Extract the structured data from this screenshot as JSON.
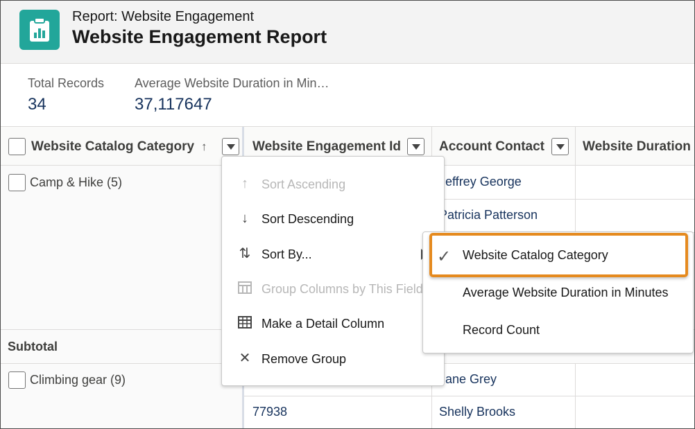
{
  "header": {
    "object_label": "Report: Website Engagement",
    "title": "Website Engagement Report",
    "icon": "report-icon",
    "icon_color": "#22a69a"
  },
  "summary": {
    "metrics": [
      {
        "label": "Total Records",
        "value": "34"
      },
      {
        "label": "Average Website Duration in Min…",
        "value": "37,117647"
      }
    ]
  },
  "table": {
    "columns": [
      {
        "label": "Website Catalog Category",
        "sort_icon": "arrow-up-icon"
      },
      {
        "label": "Website Engagement Id"
      },
      {
        "label": "Account Contact"
      },
      {
        "label": "Website Duration i"
      }
    ],
    "groups": [
      {
        "label": "Camp & Hike (5)"
      },
      {
        "label": "Climbing gear (9)"
      }
    ],
    "subtotal_label": "Subtotal",
    "rows": [
      {
        "id": "",
        "contact": "Jeffrey George"
      },
      {
        "id": "",
        "contact": "Patricia Patterson"
      },
      {
        "id": "",
        "contact": "Jane Grey"
      },
      {
        "id": "77938",
        "contact": "Shelly Brooks"
      }
    ]
  },
  "column_menu": {
    "items": [
      {
        "label": "Sort Ascending",
        "icon": "arrow-up-icon",
        "disabled": true
      },
      {
        "label": "Sort Descending",
        "icon": "arrow-down-icon",
        "disabled": false
      },
      {
        "label": "Sort By...",
        "icon": "sort-icon",
        "disabled": false
      },
      {
        "label": "Group Columns by This Field",
        "icon": "group-columns-icon",
        "disabled": true
      },
      {
        "label": "Make a Detail Column",
        "icon": "detail-column-icon",
        "disabled": false
      },
      {
        "label": "Remove Group",
        "icon": "close-icon",
        "disabled": false
      }
    ]
  },
  "sort_by_submenu": {
    "items": [
      {
        "label": "Website Catalog Category",
        "checked": true
      },
      {
        "label": "Average Website Duration in Minutes",
        "checked": false
      },
      {
        "label": "Record Count",
        "checked": false
      }
    ]
  },
  "colors": {
    "accent_highlight": "#e58a1f",
    "link": "#16325c"
  }
}
